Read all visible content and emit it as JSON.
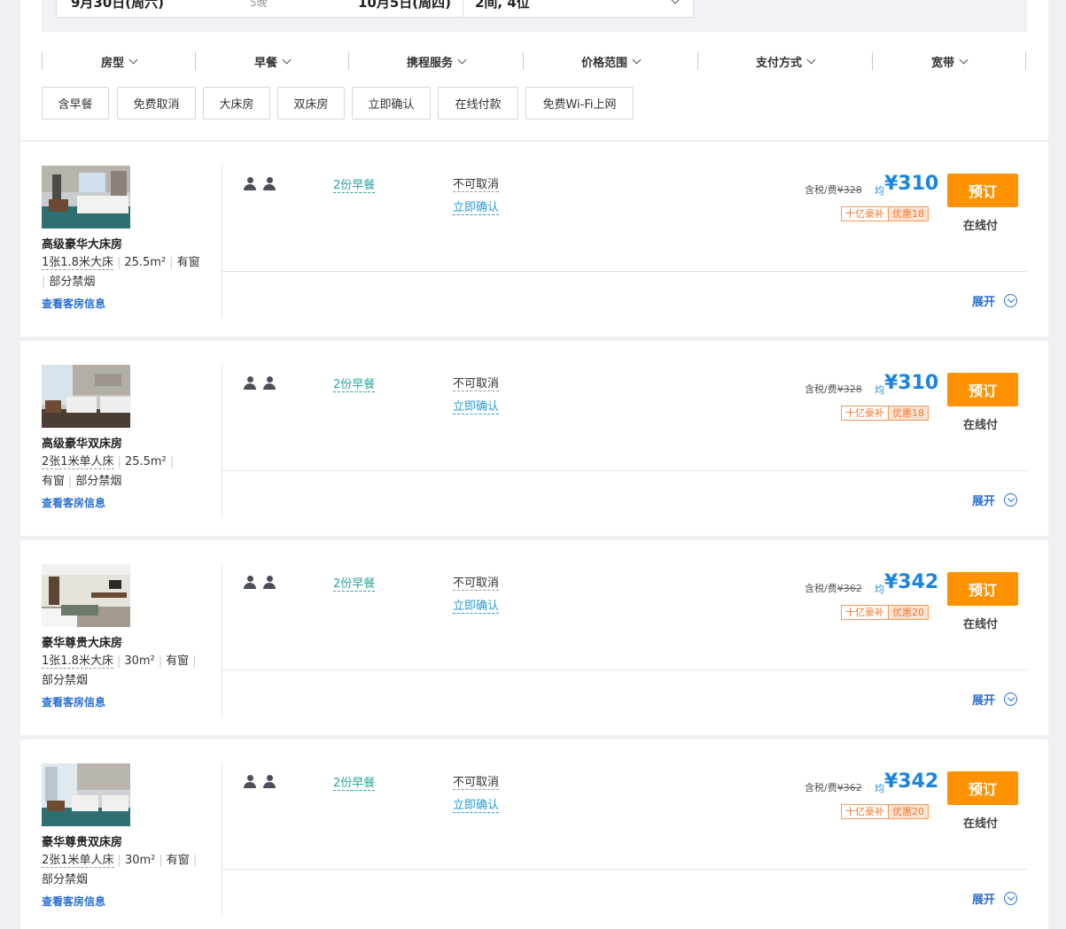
{
  "search": {
    "checkin": "9月30日(周六)",
    "nights": "5晚",
    "checkout": "10月5日(周四)",
    "rooms_guests": "2间, 4位"
  },
  "filters": [
    "房型",
    "早餐",
    "携程服务",
    "价格范围",
    "支付方式",
    "宽带"
  ],
  "tags": [
    "含早餐",
    "免费取消",
    "大床房",
    "双床房",
    "立即确认",
    "在线付款",
    "免费Wi-Fi上网"
  ],
  "rooms": [
    {
      "name": "高级豪华大床房",
      "bed": "1张1.8米大床",
      "area": "25.5m²",
      "window": "有窗",
      "smoking": "部分禁烟",
      "info_link": "查看客房信息",
      "breakfast": "2份早餐",
      "cancel": "不可取消",
      "confirm": "立即确认",
      "tax_label": "含税/费",
      "original_price": "¥328",
      "avg_label": "均",
      "price": "¥310",
      "badge_a": "十亿豪补",
      "badge_b": "优惠18",
      "book": "预订",
      "pay": "在线付",
      "expand": "展开"
    },
    {
      "name": "高级豪华双床房",
      "bed": "2张1米单人床",
      "area": "25.5m²",
      "window": "有窗",
      "smoking": "部分禁烟",
      "info_link": "查看客房信息",
      "breakfast": "2份早餐",
      "cancel": "不可取消",
      "confirm": "立即确认",
      "tax_label": "含税/费",
      "original_price": "¥328",
      "avg_label": "均",
      "price": "¥310",
      "badge_a": "十亿豪补",
      "badge_b": "优惠18",
      "book": "预订",
      "pay": "在线付",
      "expand": "展开"
    },
    {
      "name": "豪华尊贵大床房",
      "bed": "1张1.8米大床",
      "area": "30m²",
      "window": "有窗",
      "smoking": "部分禁烟",
      "info_link": "查看客房信息",
      "breakfast": "2份早餐",
      "cancel": "不可取消",
      "confirm": "立即确认",
      "tax_label": "含税/费",
      "original_price": "¥362",
      "avg_label": "均",
      "price": "¥342",
      "badge_a": "十亿豪补",
      "badge_b": "优惠20",
      "book": "预订",
      "pay": "在线付",
      "expand": "展开"
    },
    {
      "name": "豪华尊贵双床房",
      "bed": "2张1米单人床",
      "area": "30m²",
      "window": "有窗",
      "smoking": "部分禁烟",
      "info_link": "查看客房信息",
      "breakfast": "2份早餐",
      "cancel": "不可取消",
      "confirm": "立即确认",
      "tax_label": "含税/费",
      "original_price": "¥362",
      "avg_label": "均",
      "price": "¥342",
      "badge_a": "十亿豪补",
      "badge_b": "优惠20",
      "book": "预订",
      "pay": "在线付",
      "expand": "展开"
    }
  ],
  "colors": {
    "accent_blue": "#1a84e0",
    "book_orange": "#ff9200",
    "breakfast_teal": "#2aa5a0",
    "badge_orange": "#f0782e"
  }
}
